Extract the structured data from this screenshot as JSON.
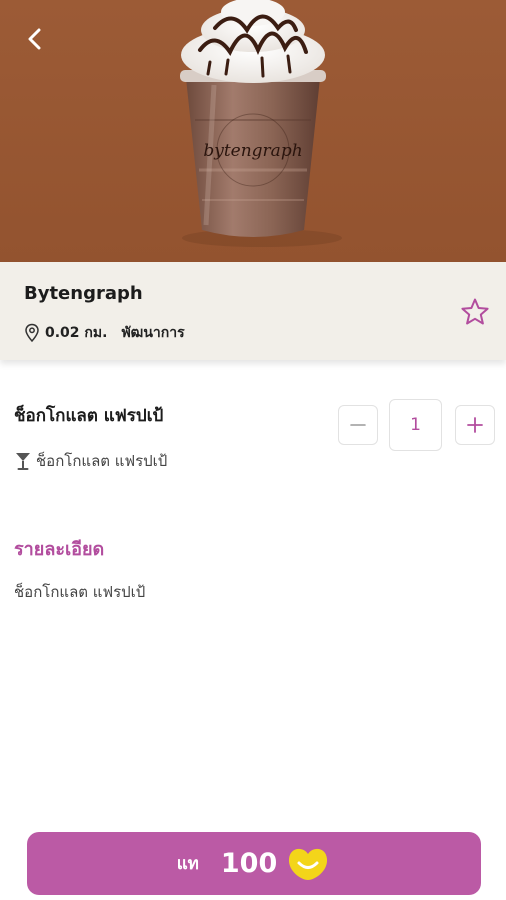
{
  "header": {
    "back_icon": "chevron-left-icon",
    "hero_image": "chocolate-frappe-cup",
    "cup_brand": "bytengraph"
  },
  "shop": {
    "name": "Bytengraph",
    "distance": "0.02 กม.",
    "area": "พัฒนาการ",
    "location_icon": "location-pin-icon",
    "favorite_icon": "star-outline-icon"
  },
  "product": {
    "name": "ช็อกโกแลต แฟรปเป้",
    "category": "ช็อกโกแลต แฟรปเป้",
    "category_icon": "cocktail-glass-icon",
    "quantity": "1",
    "minus_label": "−",
    "plus_label": "+"
  },
  "details": {
    "title": "รายละเอียด",
    "text": "ช็อกโกแลต แฟรปเป้"
  },
  "buy_button": {
    "label": "แท",
    "price": "100",
    "coin_icon": "smile-coin-icon"
  },
  "colors": {
    "accent": "#b24d9e",
    "button": "#bb5aa5",
    "hero_bg": "#9a5935",
    "shop_bar_bg": "#f2efe9",
    "coin": "#f3d51a"
  }
}
